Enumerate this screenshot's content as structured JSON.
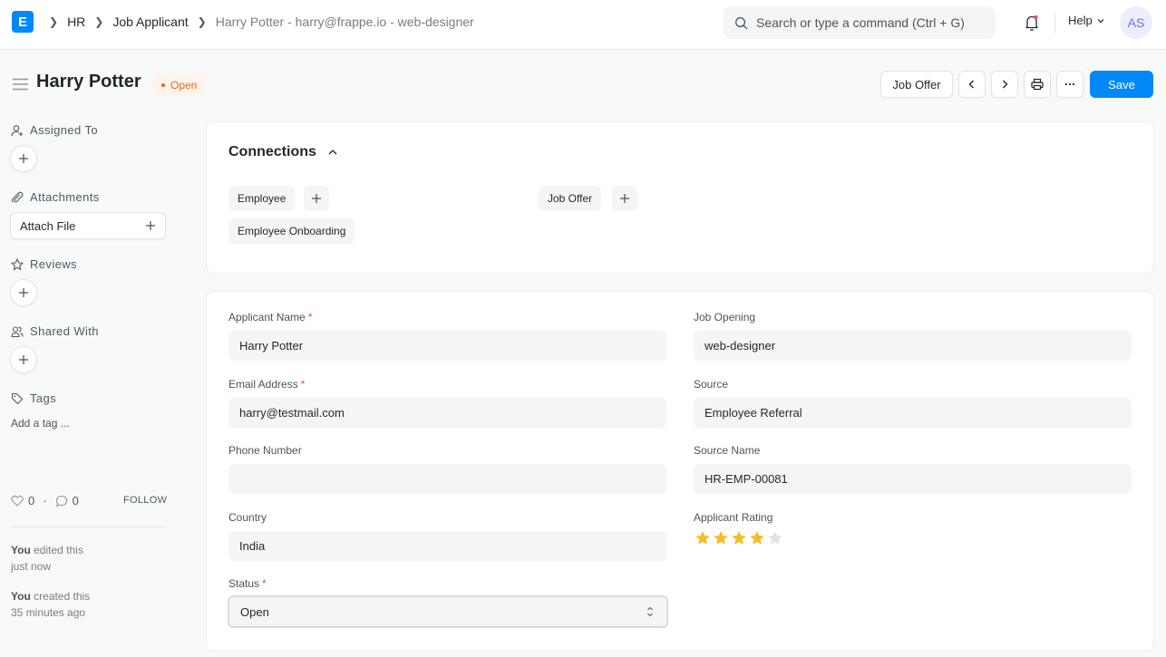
{
  "navbar": {
    "logo_letter": "E",
    "breadcrumbs": [
      "HR",
      "Job Applicant",
      "Harry Potter - harry@frappe.io - web-designer"
    ],
    "search_placeholder": "Search or type a command (Ctrl + G)",
    "help_label": "Help",
    "avatar_initials": "AS"
  },
  "page": {
    "title": "Harry Potter",
    "status": "Open",
    "actions": {
      "job_offer": "Job Offer",
      "save": "Save"
    }
  },
  "sidebar": {
    "assigned_to": "Assigned To",
    "attachments": "Attachments",
    "attach_file": "Attach File",
    "reviews": "Reviews",
    "shared_with": "Shared With",
    "tags": "Tags",
    "add_tag": "Add a tag ...",
    "likes": "0",
    "comments": "0",
    "follow": "FOLLOW",
    "timeline": [
      {
        "who": "You",
        "action": "edited this",
        "when": "just now"
      },
      {
        "who": "You",
        "action": "created this",
        "when": "35 minutes ago"
      }
    ]
  },
  "connections": {
    "title": "Connections",
    "items": [
      "Employee",
      "Employee Onboarding",
      "Job Offer"
    ]
  },
  "form": {
    "applicant_name": {
      "label": "Applicant Name",
      "value": "Harry Potter"
    },
    "email_address": {
      "label": "Email Address",
      "value": "harry@testmail.com"
    },
    "phone_number": {
      "label": "Phone Number",
      "value": ""
    },
    "country": {
      "label": "Country",
      "value": "India"
    },
    "status": {
      "label": "Status",
      "value": "Open"
    },
    "job_opening": {
      "label": "Job Opening",
      "value": "web-designer"
    },
    "source": {
      "label": "Source",
      "value": "Employee Referral"
    },
    "source_name": {
      "label": "Source Name",
      "value": "HR-EMP-00081"
    },
    "applicant_rating": {
      "label": "Applicant Rating",
      "value": 4,
      "max": 5
    },
    "required_mark": "*"
  },
  "colors": {
    "primary": "#0289f7",
    "status_open": "#e86c13",
    "star_filled": "#f5bd1f",
    "star_empty": "#dfe3e7"
  }
}
